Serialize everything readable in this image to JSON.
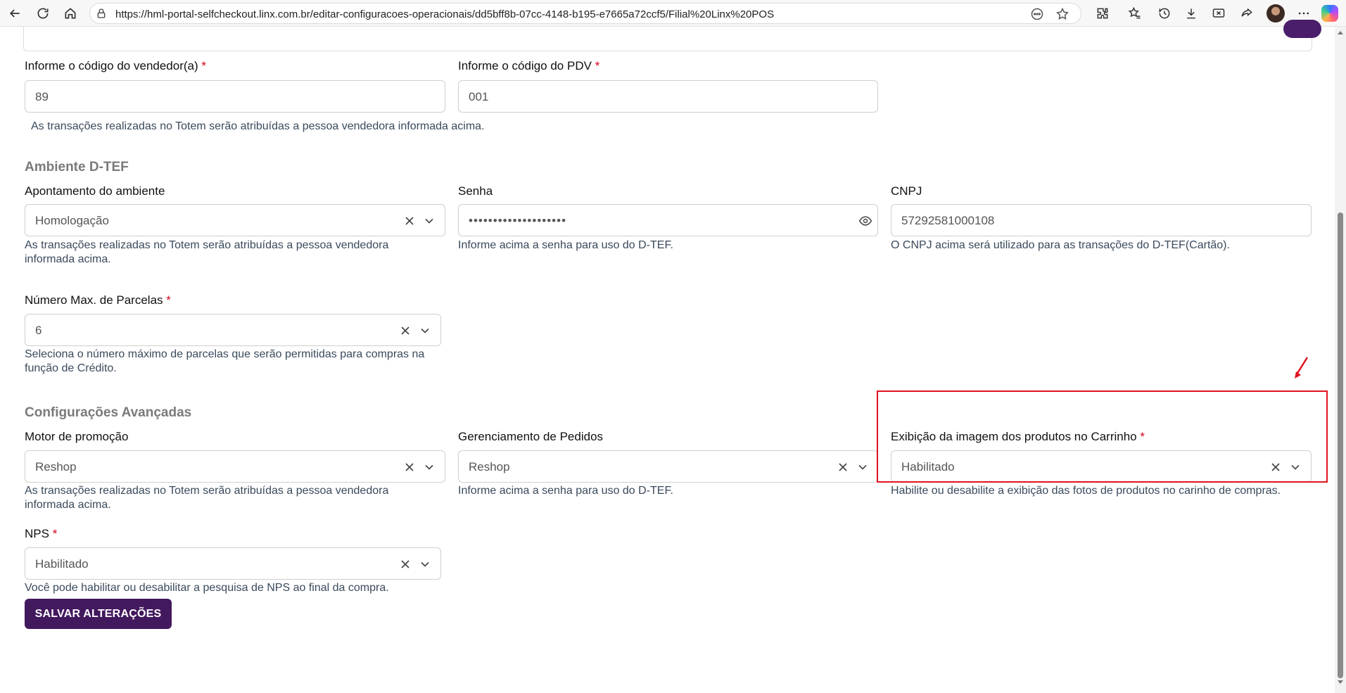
{
  "browser": {
    "url": "https://hml-portal-selfcheckout.linx.com.br/editar-configuracoes-operacionais/dd5bff8b-07cc-4148-b195-e7665a72ccf5/Filial%20Linx%20POS"
  },
  "vendor": {
    "label": "Informe o código do vendedor(a)",
    "value": "89",
    "help": "As transações realizadas no Totem serão atribuídas a pessoa vendedora informada acima."
  },
  "pdv": {
    "label": "Informe o código do PDV",
    "value": "001"
  },
  "dtef": {
    "section_title": "Ambiente D-TEF",
    "environment": {
      "label": "Apontamento do ambiente",
      "value": "Homologação",
      "help": "As transações realizadas no Totem serão atribuídas a pessoa vendedora informada acima."
    },
    "password": {
      "label": "Senha",
      "value": "••••••••••••••••••••",
      "help": "Informe acima a senha para uso do D-TEF."
    },
    "cnpj": {
      "label": "CNPJ",
      "value": "57292581000108",
      "help": "O CNPJ acima será utilizado para as transações do D-TEF(Cartão)."
    },
    "installments": {
      "label": "Número Max. de Parcelas",
      "value": "6",
      "help": "Seleciona o número máximo de parcelas que serão permitidas para compras na função de Crédito."
    }
  },
  "advanced": {
    "section_title": "Configurações Avançadas",
    "promotion": {
      "label": "Motor de promoção",
      "value": "Reshop",
      "help": "As transações realizadas no Totem serão atribuídas a pessoa vendedora informada acima."
    },
    "orders": {
      "label": "Gerenciamento de Pedidos",
      "value": "Reshop",
      "help": "Informe acima a senha para uso do D-TEF."
    },
    "cart_image": {
      "label": "Exibição da imagem dos produtos no Carrinho",
      "value": "Habilitado",
      "help": "Habilite ou desabilite a exibição das fotos de produtos no carinho de compras."
    },
    "nps": {
      "label": "NPS",
      "value": "Habilitado",
      "help": "Você pode habilitar ou desabilitar a pesquisa de NPS ao final da compra."
    }
  },
  "required_mark": "*",
  "save_button": "SALVAR ALTERAÇÕES"
}
